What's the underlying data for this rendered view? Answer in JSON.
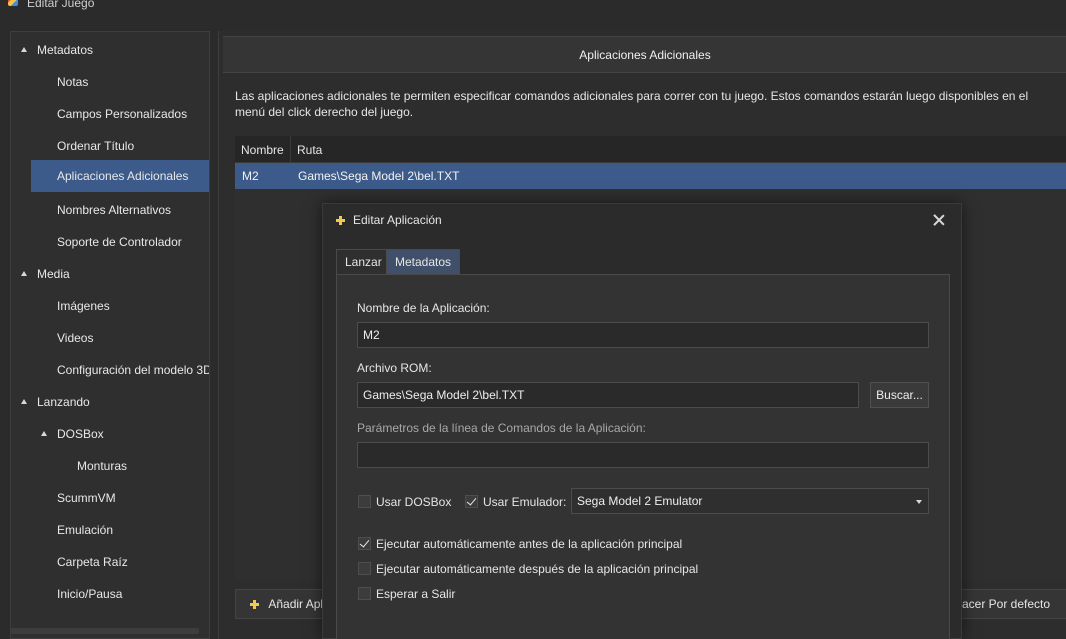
{
  "window": {
    "title": "Editar Juego"
  },
  "sidebar": {
    "items": [
      {
        "label": "Metadatos"
      },
      {
        "label": "Notas"
      },
      {
        "label": "Campos Personalizados"
      },
      {
        "label": "Ordenar Título"
      },
      {
        "label": "Aplicaciones Adicionales"
      },
      {
        "label": "Nombres Alternativos"
      },
      {
        "label": "Soporte de Controlador"
      },
      {
        "label": "Media"
      },
      {
        "label": "Imágenes"
      },
      {
        "label": "Videos"
      },
      {
        "label": "Configuración del modelo 3D"
      },
      {
        "label": "Lanzando"
      },
      {
        "label": "DOSBox"
      },
      {
        "label": "Monturas"
      },
      {
        "label": "ScummVM"
      },
      {
        "label": "Emulación"
      },
      {
        "label": "Carpeta Raíz"
      },
      {
        "label": "Inicio/Pausa"
      }
    ],
    "selected": "Aplicaciones Adicionales"
  },
  "panel": {
    "title": "Aplicaciones Adicionales",
    "description": "Las aplicaciones adicionales te permiten especificar comandos adicionales para correr con tu juego. Estos comandos estarán luego disponibles en el menú del click derecho del juego.",
    "columns": [
      "Nombre",
      "Ruta"
    ],
    "rows": [
      {
        "name": "M2",
        "path": "Games\\Sega Model 2\\bel.TXT"
      }
    ],
    "add_button": "Añadir Apl",
    "default_button": "acer Por defecto"
  },
  "dialog": {
    "title": "Editar Aplicación",
    "tabs": [
      "Lanzar",
      "Metadatos"
    ],
    "active_tab": "Lanzar",
    "app_name_label": "Nombre de la Aplicación:",
    "app_name_value": "M2",
    "rom_label": "Archivo ROM:",
    "rom_value": "Games\\Sega Model 2\\bel.TXT",
    "browse_button": "Buscar...",
    "params_label": "Parámetros de la línea de Comandos de la Aplicación:",
    "params_value": "",
    "use_dosbox_label": "Usar DOSBox",
    "use_dosbox_checked": false,
    "use_emulator_label": "Usar Emulador:",
    "use_emulator_checked": true,
    "emulator_value": "Sega Model 2 Emulator",
    "run_before_label": "Ejecutar automáticamente antes de la aplicación principal",
    "run_before_checked": true,
    "run_after_label": "Ejecutar automáticamente después de la aplicación principal",
    "run_after_checked": false,
    "wait_exit_label": "Esperar a Salir",
    "wait_exit_checked": false
  },
  "colors": {
    "background": "#2b2b2b",
    "selection": "#3d5b8a",
    "accent_icon": "#f2c94c"
  }
}
